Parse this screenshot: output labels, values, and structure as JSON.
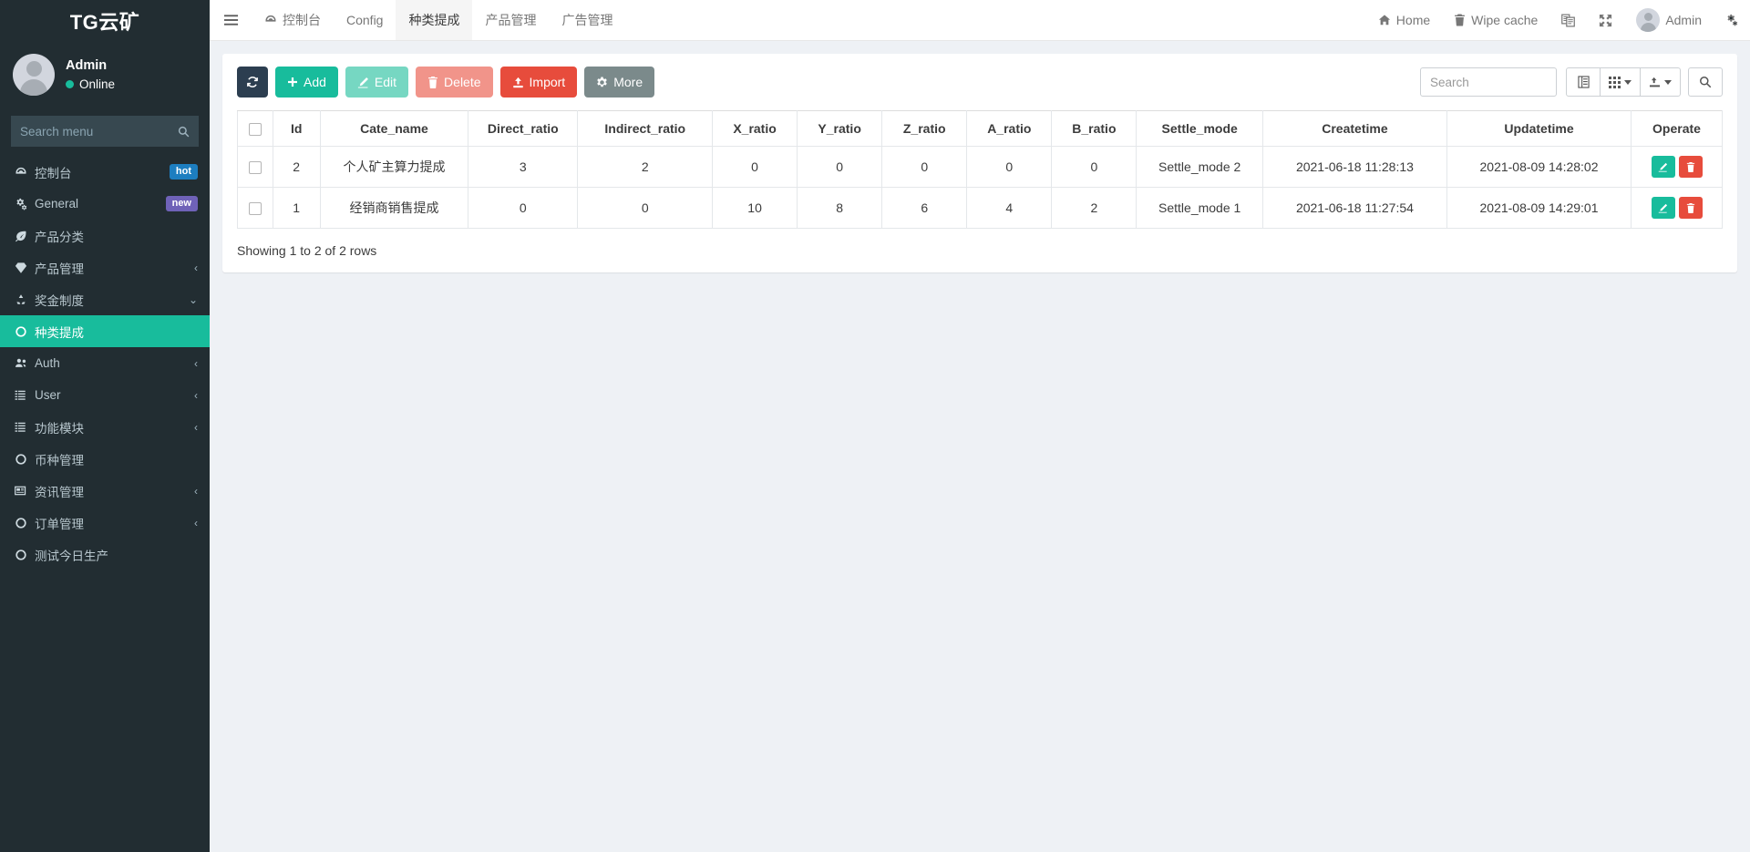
{
  "sidebar": {
    "brand": "TG云矿",
    "user": {
      "name": "Admin",
      "status": "Online"
    },
    "search": {
      "placeholder": "Search menu",
      "value": "",
      "icon": "search-icon"
    },
    "items": [
      {
        "label": "控制台",
        "icon": "dashboard-icon",
        "badge": "hot",
        "badge_type": "hot",
        "caret": "",
        "active": false
      },
      {
        "label": "General",
        "icon": "cogs-icon",
        "badge": "new",
        "badge_type": "new",
        "caret": "",
        "active": false
      },
      {
        "label": "产品分类",
        "icon": "leaf-icon",
        "badge": "",
        "badge_type": "",
        "caret": "",
        "active": false
      },
      {
        "label": "产品管理",
        "icon": "gem-icon",
        "badge": "",
        "badge_type": "",
        "caret": "‹",
        "active": false
      },
      {
        "label": "奖金制度",
        "icon": "recycle-icon",
        "badge": "",
        "badge_type": "",
        "caret": "⌄",
        "active": false
      },
      {
        "label": "种类提成",
        "icon": "circle-o-icon",
        "badge": "",
        "badge_type": "",
        "caret": "",
        "active": true
      },
      {
        "label": "Auth",
        "icon": "users-icon",
        "badge": "",
        "badge_type": "",
        "caret": "‹",
        "active": false
      },
      {
        "label": "User",
        "icon": "list-icon",
        "badge": "",
        "badge_type": "",
        "caret": "‹",
        "active": false
      },
      {
        "label": "功能模块",
        "icon": "list-icon",
        "badge": "",
        "badge_type": "",
        "caret": "‹",
        "active": false
      },
      {
        "label": "币种管理",
        "icon": "circle-o-icon",
        "badge": "",
        "badge_type": "",
        "caret": "",
        "active": false
      },
      {
        "label": "资讯管理",
        "icon": "newspaper-icon",
        "badge": "",
        "badge_type": "",
        "caret": "‹",
        "active": false
      },
      {
        "label": "订单管理",
        "icon": "circle-o-icon",
        "badge": "",
        "badge_type": "",
        "caret": "‹",
        "active": false
      },
      {
        "label": "测试今日生产",
        "icon": "circle-o-icon",
        "badge": "",
        "badge_type": "",
        "caret": "",
        "active": false
      }
    ]
  },
  "topnav": {
    "menu_icon": "hamburger-icon",
    "tabs": [
      {
        "label": "控制台",
        "icon": "dashboard-icon",
        "active": false
      },
      {
        "label": "Config",
        "icon": "",
        "active": false
      },
      {
        "label": "种类提成",
        "icon": "",
        "active": true
      },
      {
        "label": "产品管理",
        "icon": "",
        "active": false
      },
      {
        "label": "广告管理",
        "icon": "",
        "active": false
      }
    ],
    "right": [
      {
        "label": "Home",
        "icon": "home-icon"
      },
      {
        "label": "Wipe cache",
        "icon": "trash-icon"
      },
      {
        "label": "",
        "icon": "language-icon"
      },
      {
        "label": "",
        "icon": "fullscreen-icon"
      },
      {
        "label": "Admin",
        "icon": "avatar-icon"
      },
      {
        "label": "",
        "icon": "cogs-icon"
      }
    ]
  },
  "toolbar": {
    "refresh_label": "",
    "add_label": "Add",
    "edit_label": "Edit",
    "delete_label": "Delete",
    "import_label": "Import",
    "more_label": "More",
    "search_placeholder": "Search",
    "search_value": "",
    "column_toggle_icon": "columns-icon",
    "grid_icon": "grid-icon",
    "export_icon": "export-icon",
    "search_icon": "search-icon"
  },
  "table": {
    "columns": [
      "",
      "Id",
      "Cate_name",
      "Direct_ratio",
      "Indirect_ratio",
      "X_ratio",
      "Y_ratio",
      "Z_ratio",
      "A_ratio",
      "B_ratio",
      "Settle_mode",
      "Createtime",
      "Updatetime",
      "Operate"
    ],
    "rows": [
      {
        "id": "2",
        "cate_name": "个人矿主算力提成",
        "direct_ratio": "3",
        "indirect_ratio": "2",
        "x_ratio": "0",
        "y_ratio": "0",
        "z_ratio": "0",
        "a_ratio": "0",
        "b_ratio": "0",
        "settle_mode": "Settle_mode 2",
        "settle_mode_highlight": true,
        "createtime": "2021-06-18 11:28:13",
        "updatetime": "2021-08-09 14:28:02"
      },
      {
        "id": "1",
        "cate_name": "经销商销售提成",
        "direct_ratio": "0",
        "indirect_ratio": "0",
        "x_ratio": "10",
        "y_ratio": "8",
        "z_ratio": "6",
        "a_ratio": "4",
        "b_ratio": "2",
        "settle_mode": "Settle_mode 1",
        "settle_mode_highlight": false,
        "createtime": "2021-06-18 11:27:54",
        "updatetime": "2021-08-09 14:29:01"
      }
    ],
    "footer": "Showing 1 to 2 of 2 rows"
  },
  "colors": {
    "sidebar_bg": "#222d32",
    "accent_teal": "#18bc9c",
    "danger_red": "#e74c3c",
    "dark_navy": "#2c3e50",
    "page_bg": "#eef1f5",
    "badge_hot": "#1d7ec0",
    "badge_new": "#6f62b8"
  }
}
